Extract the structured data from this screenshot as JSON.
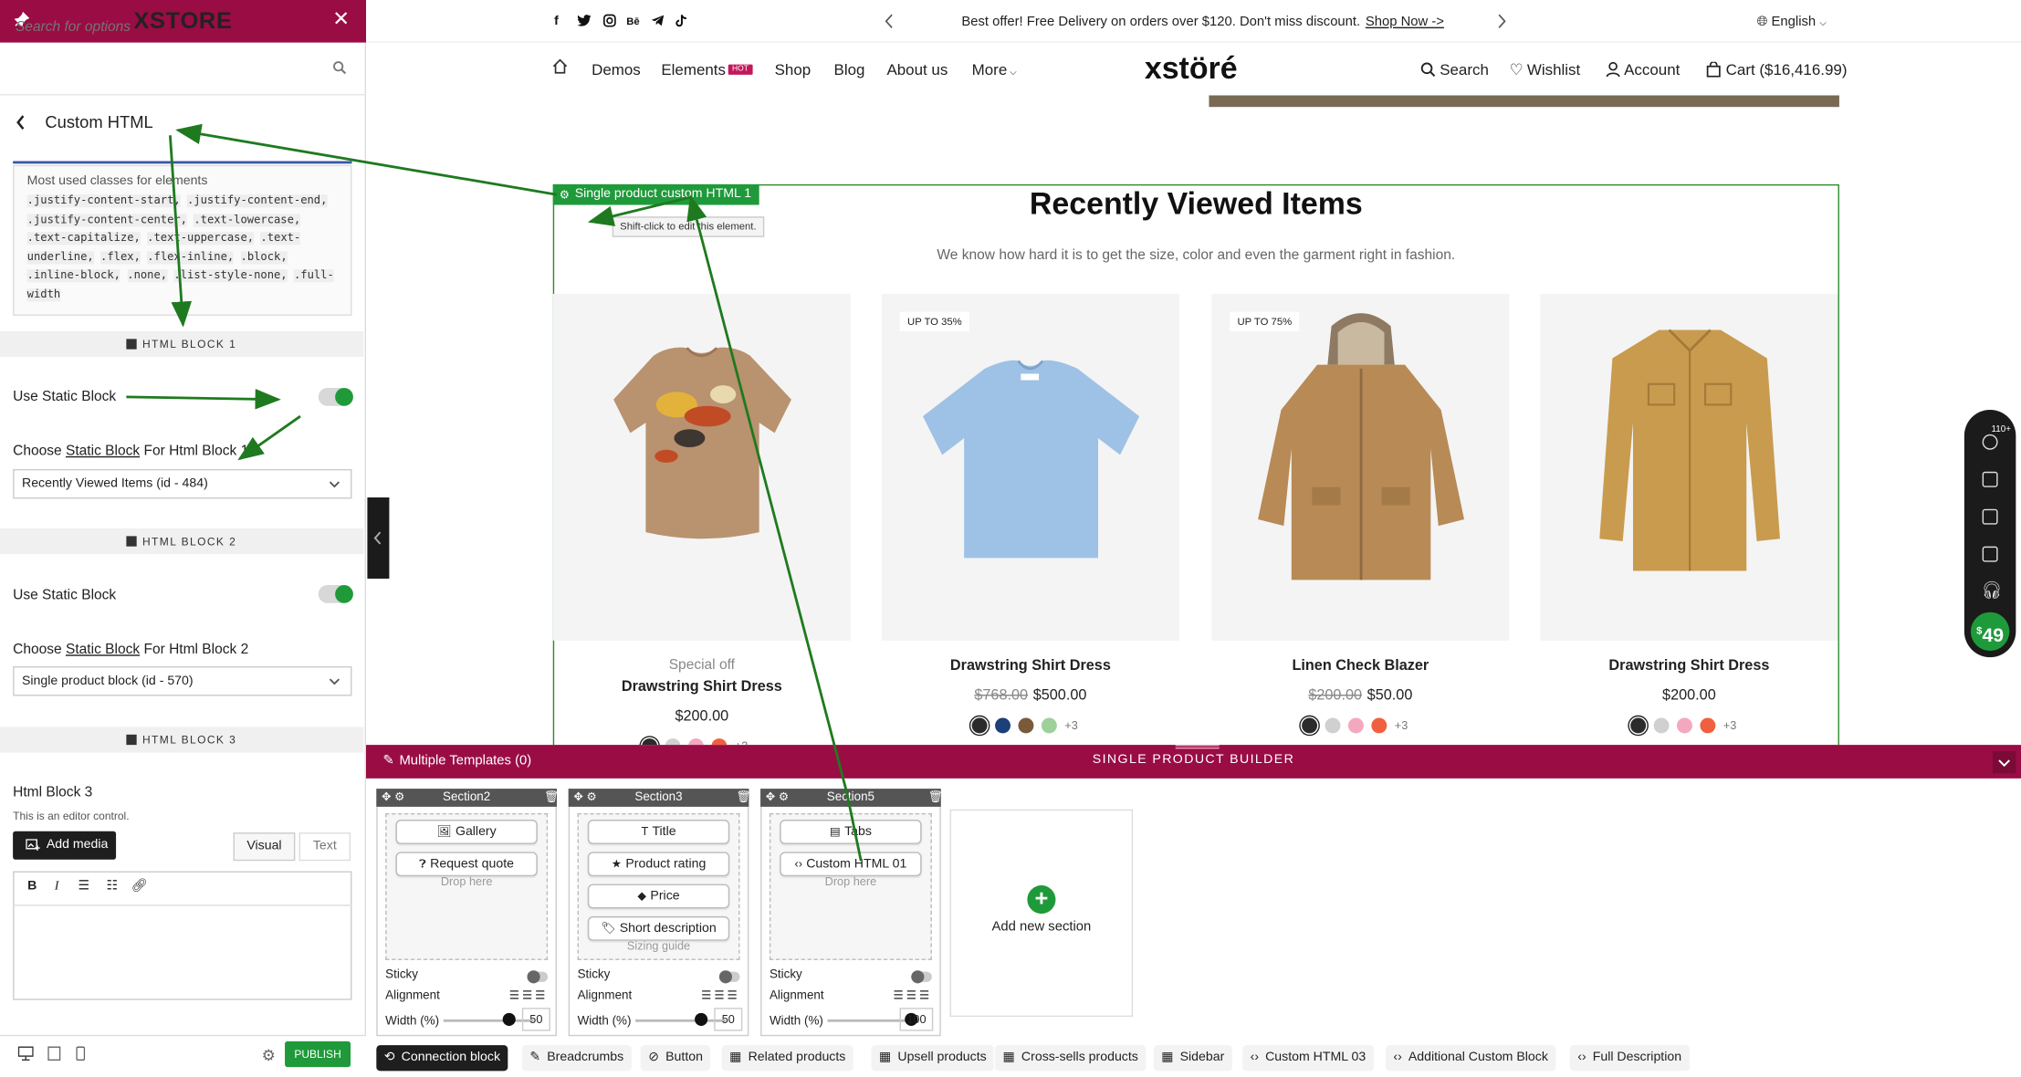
{
  "sidebar": {
    "brand": "XSTORE",
    "search_placeholder": "Search for options",
    "panel_title": "Custom HTML",
    "classes_label": "Most used classes for elements",
    "classes": [
      ".justify-content-start,",
      ".justify-content-end,",
      ".justify-content-center,",
      ".text-lowercase,",
      ".text-capitalize,",
      ".text-uppercase,",
      ".text-underline,",
      ".flex,",
      ".flex-inline,",
      ".block,",
      ".inline-block,",
      ".none,",
      ".list-style-none,",
      ".full-width"
    ],
    "html_block_1": {
      "heading": "HTML BLOCK 1",
      "use_static_label": "Use Static Block",
      "choose_prefix": "Choose",
      "choose_link": "Static Block",
      "choose_suffix": "For Html Block 1",
      "selected": "Recently Viewed Items (id - 484)"
    },
    "html_block_2": {
      "heading": "HTML BLOCK 2",
      "use_static_label": "Use Static Block",
      "choose_prefix": "Choose",
      "choose_link": "Static Block",
      "choose_suffix": "For Html Block 2",
      "selected": "Single product block (id - 570)"
    },
    "html_block_3": {
      "heading": "HTML BLOCK 3",
      "label": "Html Block 3",
      "sub": "This is an editor control.",
      "add_media": "Add media",
      "visual": "Visual",
      "text": "Text"
    },
    "publish": "PUBLISH"
  },
  "topbar": {
    "promo": "Best offer! Free Delivery on orders over $120. Don't miss discount.",
    "promo_link": "Shop Now ->",
    "language": "English"
  },
  "nav": {
    "demos": "Demos",
    "elements": "Elements",
    "hot": "HOT",
    "shop": "Shop",
    "blog": "Blog",
    "about": "About us",
    "more": "More",
    "logo": "xstöré",
    "search": "Search",
    "wishlist": "Wishlist",
    "account": "Account",
    "cart": "Cart ($16,416.99)"
  },
  "block": {
    "badge": "Single product custom HTML 1",
    "tooltip": "Shift-click to edit this element.",
    "title": "Recently Viewed Items",
    "subtitle": "We know how hard it is to get the size, color and even the garment right in fashion."
  },
  "products": [
    {
      "special": "Special off",
      "name": "Drawstring Shirt Dress",
      "old": "",
      "price": "$200.00",
      "badge": "",
      "swatches": [
        "#2b2b2b",
        "#d0d0d0",
        "#f4a8c0",
        "#f06040"
      ],
      "more": "+3"
    },
    {
      "special": "",
      "name": "Drawstring Shirt Dress",
      "old": "$768.00",
      "price": "$500.00",
      "badge": "UP TO 35%",
      "swatches": [
        "#2b2b2b",
        "#1d3f7a",
        "#7a5a3a",
        "#9ed09a"
      ],
      "more": "+3"
    },
    {
      "special": "",
      "name": "Linen Check Blazer",
      "old": "$200.00",
      "price": "$50.00",
      "badge": "UP TO 75%",
      "swatches": [
        "#2b2b2b",
        "#d0d0d0",
        "#f4a8c0",
        "#f06040"
      ],
      "more": "+3"
    },
    {
      "special": "",
      "name": "Drawstring Shirt Dress",
      "old": "",
      "price": "$200.00",
      "badge": "",
      "swatches": [
        "#2b2b2b",
        "#d0d0d0",
        "#f4a8c0",
        "#f06040"
      ],
      "more": "+3"
    }
  ],
  "builder": {
    "multiple_templates": "Multiple Templates (0)",
    "title": "SINGLE PRODUCT BUILDER",
    "sections": [
      {
        "name": "Section2",
        "elements": [
          "Gallery",
          "Request quote"
        ],
        "drop": "Drop here",
        "sticky": "Sticky",
        "alignment": "Alignment",
        "width_label": "Width (%)",
        "width": "50"
      },
      {
        "name": "Section3",
        "elements": [
          "Title",
          "Product rating",
          "Price",
          "Short description"
        ],
        "drop": "Sizing guide",
        "sticky": "Sticky",
        "alignment": "Alignment",
        "width_label": "Width (%)",
        "width": "50"
      },
      {
        "name": "Section5",
        "elements": [
          "Tabs",
          "Custom HTML 01"
        ],
        "drop": "Drop here",
        "sticky": "Sticky",
        "alignment": "Alignment",
        "width_label": "Width (%)",
        "width": "100"
      }
    ],
    "add_section": "Add new section",
    "tabs": [
      "Connection block",
      "Breadcrumbs",
      "Button",
      "Related products",
      "Upsell products",
      "Cross-sells products",
      "Sidebar",
      "Custom HTML 03",
      "Additional Custom Block",
      "Full Description"
    ]
  },
  "dock": {
    "count": "49",
    "count_prefix": "$",
    "badge": "110+"
  },
  "colors": {
    "brand": "#9a0c44",
    "green": "#1f9a3a",
    "arrow": "#1f7a1f"
  }
}
